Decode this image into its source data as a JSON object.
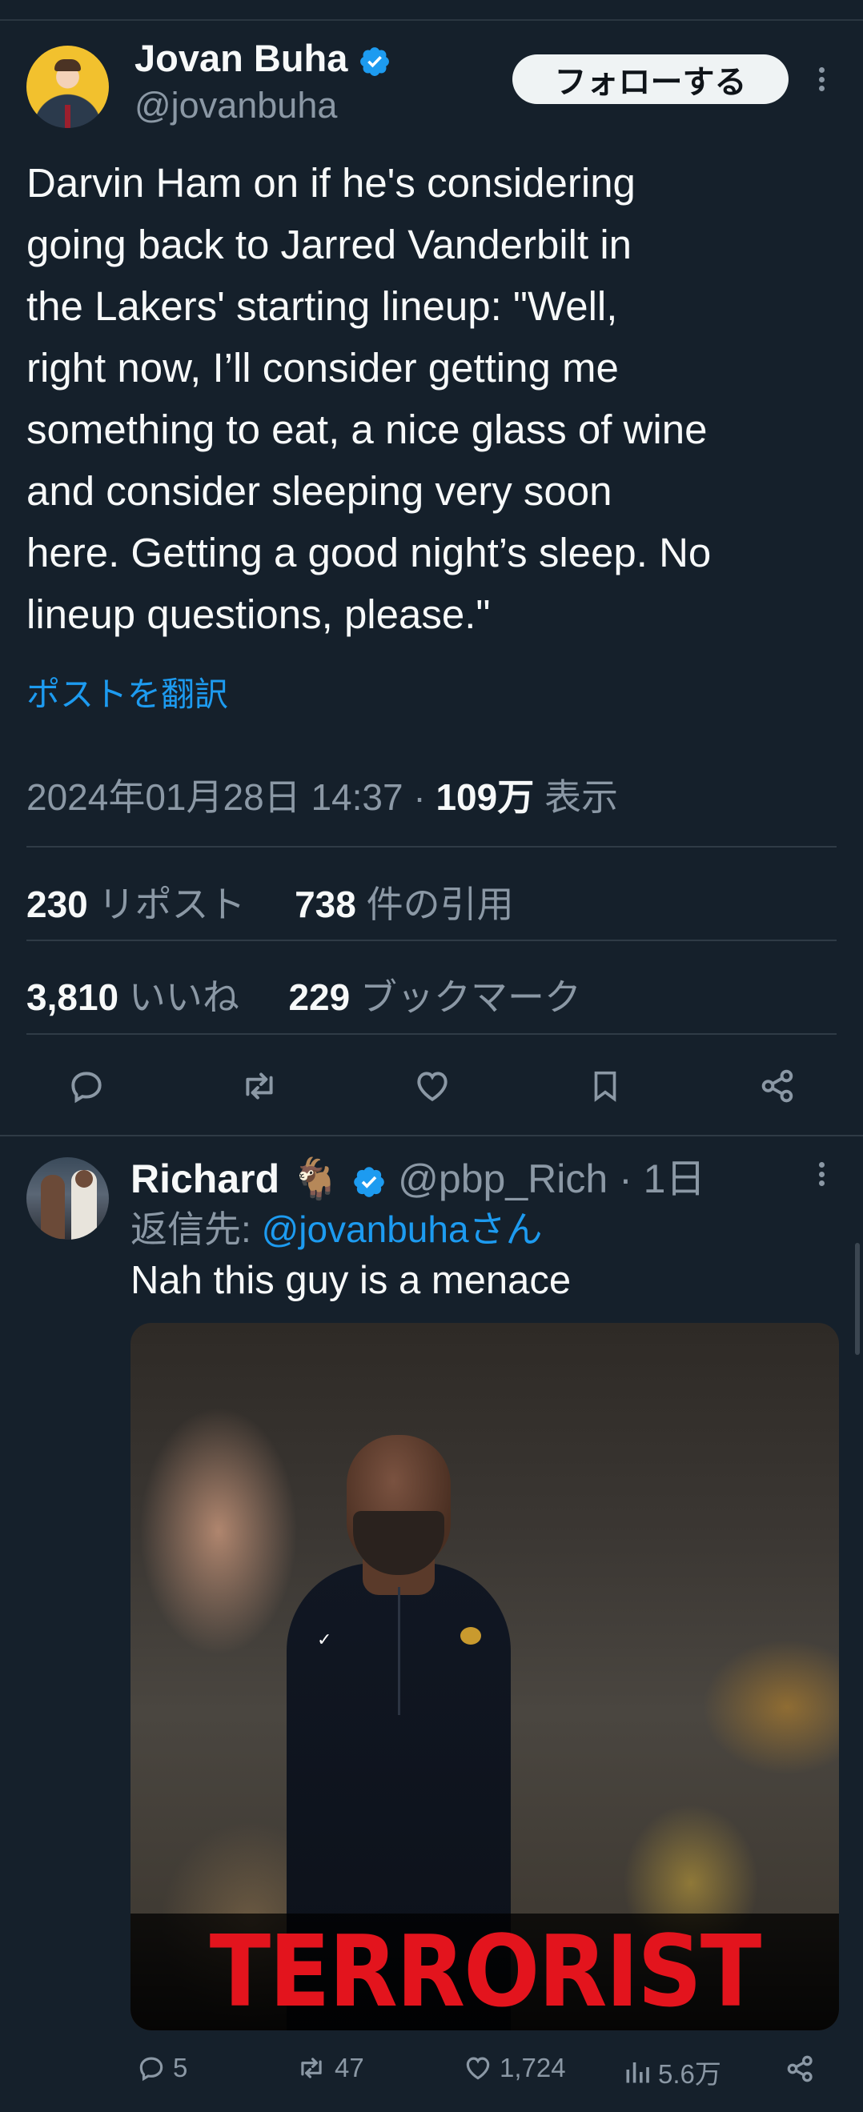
{
  "main_tweet": {
    "author_name": "Jovan Buha",
    "handle": "@jovanbuha",
    "follow_label": "フォローする",
    "text": "Darvin Ham on if he's considering\ngoing back to Jarred Vanderbilt in\nthe Lakers' starting lineup: \"Well,\nright now, I’ll consider getting me\nsomething to eat, a nice glass of wine\nand consider sleeping very soon\nhere. Getting a good night’s sleep. No\nlineup questions, please.\"",
    "translate_label": "ポストを翻訳",
    "timestamp": "2024年01月28日 14:37",
    "views_count": "109万",
    "views_label": "表示",
    "reposts_count": "230",
    "reposts_label": "リポスト",
    "quotes_count": "738",
    "quotes_label": "件の引用",
    "likes_count": "3,810",
    "likes_label": "いいね",
    "bookmarks_count": "229",
    "bookmarks_label": "ブックマーク"
  },
  "reply": {
    "author_name": "Richard",
    "emoji": "🐐",
    "handle": "@pbp_Rich",
    "time": "1日",
    "reply_to_prefix": "返信先: ",
    "reply_to_handle": "@jovanbuhaさん",
    "text": "Nah this guy is a menace",
    "image_caption": "TERRORIST",
    "replies": "5",
    "reposts": "47",
    "likes": "1,724",
    "views": "5.6万"
  },
  "colors": {
    "background": "#15202b",
    "accent": "#1d9bf0",
    "muted": "#8b98a5",
    "caption_red": "#e3141d"
  }
}
